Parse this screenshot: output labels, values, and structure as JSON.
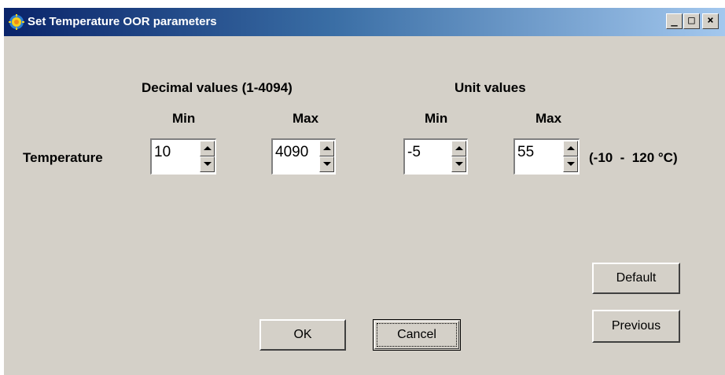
{
  "window": {
    "title": "Set Temperature OOR parameters",
    "icon": "sun-gear-icon",
    "controls": {
      "minimize": "_",
      "maximize": "□",
      "close": "×"
    }
  },
  "headers": {
    "decimal_group": "Decimal values (1-4094)",
    "unit_group": "Unit values",
    "min": "Min",
    "max": "Max"
  },
  "row": {
    "label": "Temperature",
    "decimal_min": "10",
    "decimal_max": "4090",
    "unit_min": "-5",
    "unit_max": "55",
    "range_note": "(-10  -  120 °C)"
  },
  "buttons": {
    "default": "Default",
    "previous": "Previous",
    "ok": "OK",
    "cancel": "Cancel"
  },
  "colors": {
    "titlebar_start": "#0a246a",
    "titlebar_end": "#a6caf0",
    "face": "#d4d0c8"
  }
}
